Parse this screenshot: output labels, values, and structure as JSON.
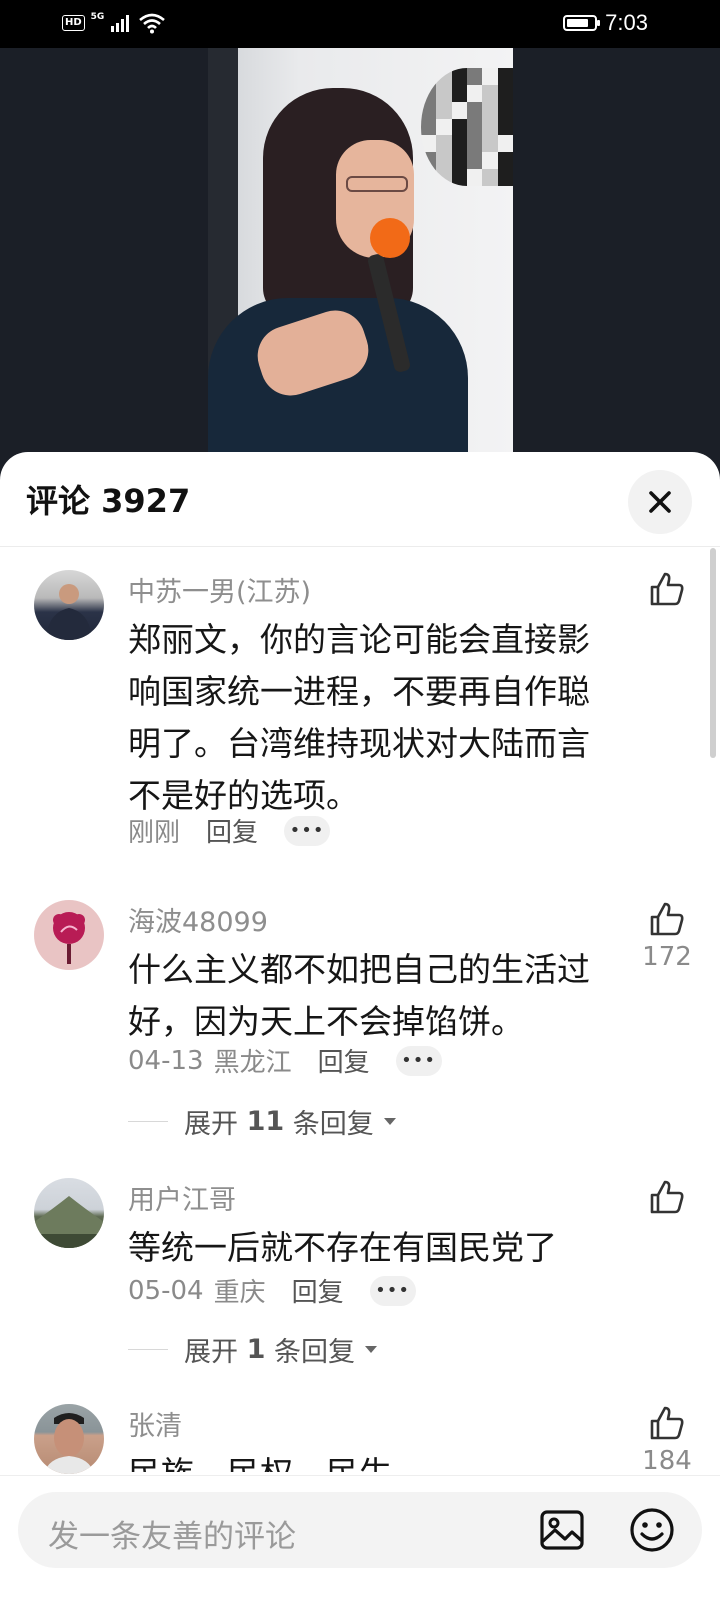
{
  "status_bar": {
    "hd": "HD",
    "network": "5G",
    "time": "7:03",
    "battery_level": 0.8
  },
  "comments_panel": {
    "title": "评论 3927",
    "close_icon": "close-icon",
    "input_placeholder": "发一条友善的评论",
    "comments": [
      {
        "username": "中苏一男(江苏)",
        "text": "郑丽文，你的言论可能会直接影响国家统一进程，不要再自作聪明了。台湾维持现状对大陆而言不是好的选项。",
        "date": "刚刚",
        "location": "",
        "reply": "回复",
        "likes": ""
      },
      {
        "username": "海波48099",
        "text": "什么主义都不如把自己的生活过好，因为天上不会掉馅饼。",
        "date": "04-13",
        "location": "黑龙江",
        "reply": "回复",
        "likes": "172",
        "expand_prefix": "展开 ",
        "expand_count": "11",
        "expand_suffix": " 条回复"
      },
      {
        "username": "用户江哥",
        "text": "等统一后就不存在有国民党了",
        "date": "05-04",
        "location": "重庆",
        "reply": "回复",
        "likes": "",
        "expand_prefix": "展开 ",
        "expand_count": "1",
        "expand_suffix": " 条回复"
      },
      {
        "username": "张清",
        "text": "民族、民权、民生。",
        "likes": "184"
      }
    ]
  }
}
